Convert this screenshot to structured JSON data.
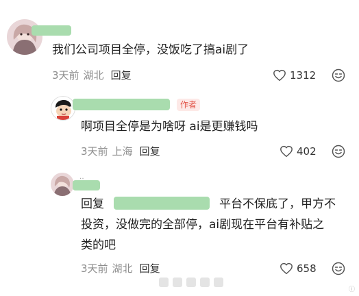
{
  "comments": [
    {
      "content": "我们公司项目全停，没饭吃了搞ai剧了",
      "time": "3天前",
      "location": "湖北",
      "reply_label": "回复",
      "likes": "1312"
    },
    {
      "badge": "作者",
      "content": "啊项目全停是为啥呀 ai是更赚钱吗",
      "time": "3天前",
      "location": "上海",
      "reply_label": "回复",
      "likes": "402"
    },
    {
      "reply_prefix": "回复",
      "content_line1_after": "平台不保底了，甲方不",
      "content_line2": "投资，没做完的全部停，ai剧现在平台有补贴之",
      "content_line3": "类的吧",
      "time": "3天前",
      "location": "湖北",
      "reply_label": "回复",
      "likes": "658",
      "name_dots": "‥"
    }
  ],
  "icons": {
    "like": "heart-outline-icon",
    "emoji": "smiley-face-icon"
  },
  "colors": {
    "name_mask": "#a9dcae",
    "author_badge": "#e2564a",
    "meta_text": "#8d8d8d"
  }
}
